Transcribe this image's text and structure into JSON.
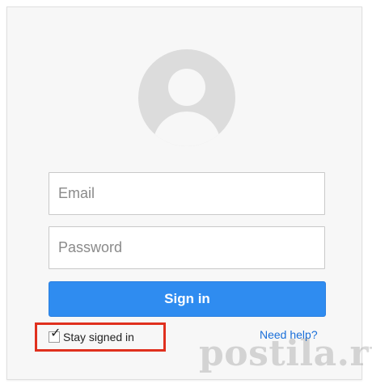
{
  "form": {
    "email_placeholder": "Email",
    "password_placeholder": "Password",
    "signin_label": "Sign in",
    "stay_signed_in_label": "Stay signed in",
    "stay_signed_in_checked": true,
    "checkmark_glyph": "✓",
    "help_label": "Need help?"
  },
  "watermark": {
    "text": "postila.ru"
  },
  "colors": {
    "accent": "#2f8cf0",
    "highlight_border": "#e0301e",
    "link": "#1a6fd9",
    "card_background": "#f7f7f7",
    "avatar": "#dcdcdc"
  }
}
